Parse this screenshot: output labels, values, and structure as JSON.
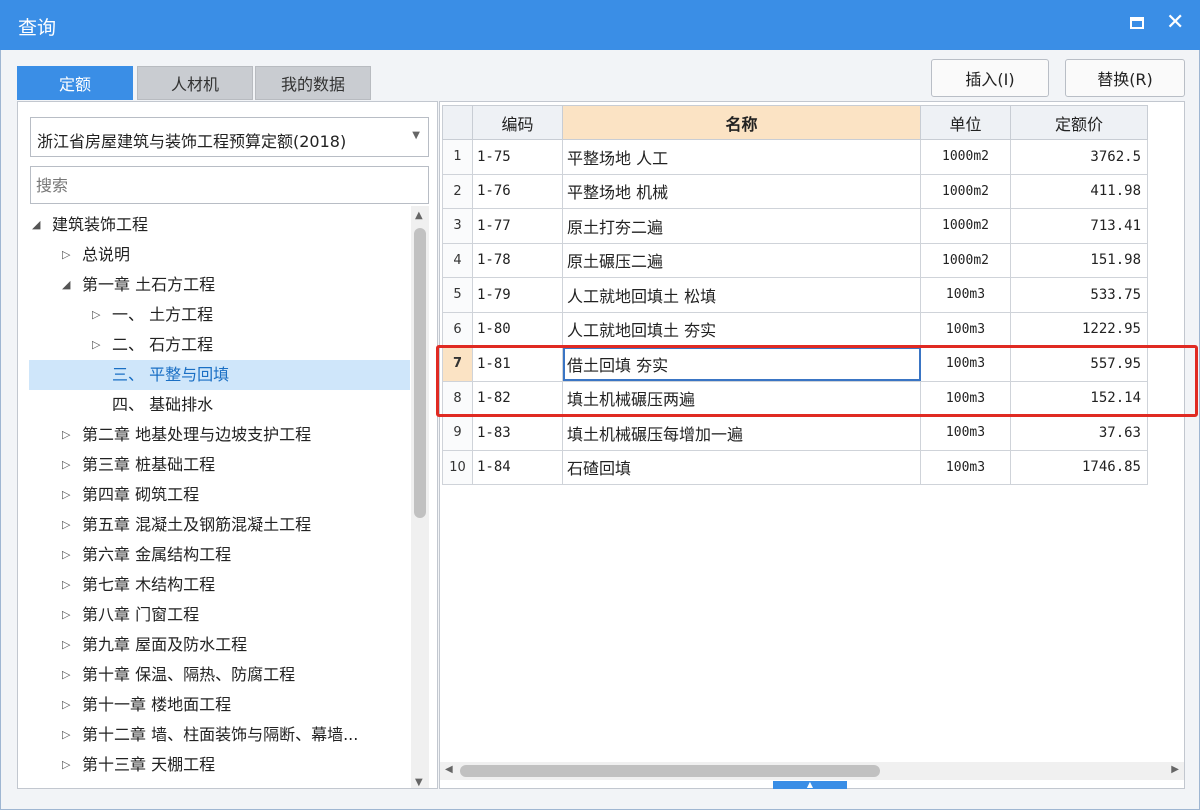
{
  "window": {
    "title": "查询"
  },
  "tabs": [
    {
      "label": "定额",
      "active": true
    },
    {
      "label": "人材机",
      "active": false
    },
    {
      "label": "我的数据",
      "active": false
    }
  ],
  "buttons": {
    "insert": "插入(I)",
    "replace": "替换(R)"
  },
  "library": {
    "selected": "浙江省房屋建筑与装饰工程预算定额(2018)"
  },
  "search": {
    "placeholder": "搜索"
  },
  "tree": [
    {
      "label": "建筑装饰工程",
      "level": 0,
      "state": "expanded"
    },
    {
      "label": "总说明",
      "level": 1,
      "state": "collapsed"
    },
    {
      "label": "第一章 土石方工程",
      "level": 1,
      "state": "expanded"
    },
    {
      "label": "一、 土方工程",
      "level": 2,
      "state": "collapsed"
    },
    {
      "label": "二、 石方工程",
      "level": 2,
      "state": "collapsed"
    },
    {
      "label": "三、 平整与回填",
      "level": 2,
      "state": "leaf",
      "selected": true
    },
    {
      "label": "四、 基础排水",
      "level": 2,
      "state": "leaf"
    },
    {
      "label": "第二章 地基处理与边坡支护工程",
      "level": 1,
      "state": "collapsed"
    },
    {
      "label": "第三章 桩基础工程",
      "level": 1,
      "state": "collapsed"
    },
    {
      "label": "第四章 砌筑工程",
      "level": 1,
      "state": "collapsed"
    },
    {
      "label": "第五章 混凝土及钢筋混凝土工程",
      "level": 1,
      "state": "collapsed"
    },
    {
      "label": "第六章 金属结构工程",
      "level": 1,
      "state": "collapsed"
    },
    {
      "label": "第七章 木结构工程",
      "level": 1,
      "state": "collapsed"
    },
    {
      "label": "第八章 门窗工程",
      "level": 1,
      "state": "collapsed"
    },
    {
      "label": "第九章 屋面及防水工程",
      "level": 1,
      "state": "collapsed"
    },
    {
      "label": "第十章 保温、隔热、防腐工程",
      "level": 1,
      "state": "collapsed"
    },
    {
      "label": "第十一章 楼地面工程",
      "level": 1,
      "state": "collapsed"
    },
    {
      "label": "第十二章 墙、柱面装饰与隔断、幕墙...",
      "level": 1,
      "state": "collapsed"
    },
    {
      "label": "第十三章 天棚工程",
      "level": 1,
      "state": "collapsed"
    }
  ],
  "grid": {
    "columns": [
      "编码",
      "名称",
      "单位",
      "定额价"
    ],
    "rows": [
      {
        "no": "1",
        "code": "1-75",
        "name": "平整场地 人工",
        "unit": "1000m2",
        "price": "3762.5"
      },
      {
        "no": "2",
        "code": "1-76",
        "name": "平整场地 机械",
        "unit": "1000m2",
        "price": "411.98"
      },
      {
        "no": "3",
        "code": "1-77",
        "name": "原土打夯二遍",
        "unit": "1000m2",
        "price": "713.41"
      },
      {
        "no": "4",
        "code": "1-78",
        "name": "原土碾压二遍",
        "unit": "1000m2",
        "price": "151.98"
      },
      {
        "no": "5",
        "code": "1-79",
        "name": "人工就地回填土 松填",
        "unit": "100m3",
        "price": "533.75"
      },
      {
        "no": "6",
        "code": "1-80",
        "name": "人工就地回填土 夯实",
        "unit": "100m3",
        "price": "1222.95"
      },
      {
        "no": "7",
        "code": "1-81",
        "name": "借土回填 夯实",
        "unit": "100m3",
        "price": "557.95"
      },
      {
        "no": "8",
        "code": "1-82",
        "name": "填土机械碾压两遍",
        "unit": "100m3",
        "price": "152.14"
      },
      {
        "no": "9",
        "code": "1-83",
        "name": "填土机械碾压每增加一遍",
        "unit": "100m3",
        "price": "37.63"
      },
      {
        "no": "10",
        "code": "1-84",
        "name": "石碴回填",
        "unit": "100m3",
        "price": "1746.85"
      }
    ],
    "current_row": 7
  },
  "colors": {
    "accent": "#3a8ee6",
    "highlight_box": "#e02a22",
    "header_active": "#fbe3c4"
  }
}
